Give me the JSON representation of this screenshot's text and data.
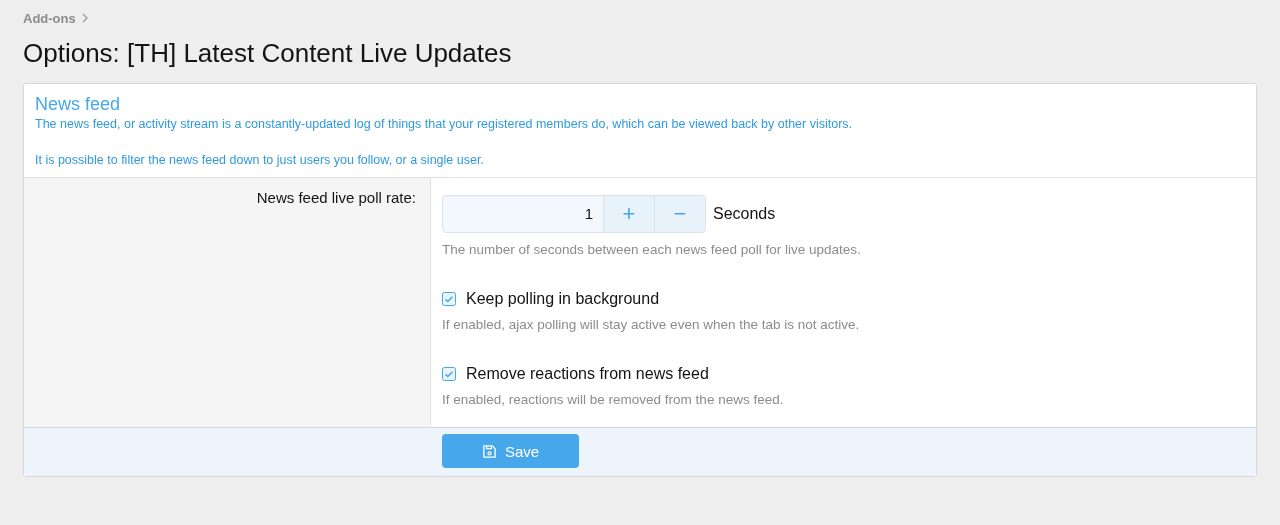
{
  "breadcrumb": [
    {
      "label": "Add-ons"
    }
  ],
  "title": "Options: [TH] Latest Content Live Updates",
  "group": {
    "title": "News feed",
    "description": [
      "The news feed, or activity stream is a constantly-updated log of things that your registered members do, which can be viewed back by other visitors.",
      "It is possible to filter the news feed down to just users you follow, or a single user."
    ]
  },
  "options": [
    {
      "kind": "spinbox",
      "label": "News feed live poll rate:",
      "value": "1",
      "increment": "+",
      "decrement": "−",
      "units": "Seconds",
      "hint": "The number of seconds between each news feed poll for live updates."
    },
    {
      "kind": "checkbox",
      "label": "Keep polling in background",
      "checked": true,
      "hint": "If enabled, ajax polling will stay active even when the tab is not active."
    },
    {
      "kind": "checkbox",
      "label": "Remove reactions from news feed",
      "checked": true,
      "hint": "If enabled, reactions will be removed from the news feed."
    }
  ],
  "save_button": "Save"
}
